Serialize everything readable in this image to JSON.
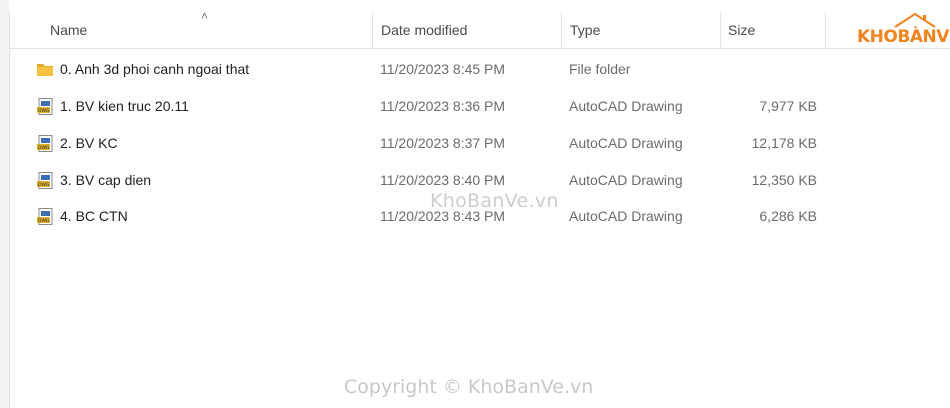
{
  "columns": {
    "name": "Name",
    "date_modified": "Date modified",
    "type": "Type",
    "size": "Size"
  },
  "files": [
    {
      "name": "0. Anh 3d phoi canh ngoai that",
      "date": "11/20/2023 8:45 PM",
      "type": "File folder",
      "size": "",
      "icon": "folder-icon"
    },
    {
      "name": "1. BV kien truc 20.11",
      "date": "11/20/2023 8:36 PM",
      "type": "AutoCAD Drawing",
      "size": "7,977 KB",
      "icon": "dwg-file-icon"
    },
    {
      "name": "2. BV KC",
      "date": "11/20/2023 8:37 PM",
      "type": "AutoCAD Drawing",
      "size": "12,178 KB",
      "icon": "dwg-file-icon"
    },
    {
      "name": "3. BV cap dien",
      "date": "11/20/2023 8:40 PM",
      "type": "AutoCAD Drawing",
      "size": "12,350 KB",
      "icon": "dwg-file-icon"
    },
    {
      "name": "4. BC CTN",
      "date": "11/20/2023 8:43 PM",
      "type": "AutoCAD Drawing",
      "size": "6,286 KB",
      "icon": "dwg-file-icon"
    }
  ],
  "watermark": {
    "center": "KhoBanVe.vn",
    "copyright": "Copyright © KhoBanVe.vn"
  },
  "logo": {
    "kho": "KHO",
    "banve": "BÀNVẼ"
  },
  "colors": {
    "accent": "#f0841e",
    "folder": "#f5c242",
    "dwg_badge": "#3a6fb5"
  }
}
